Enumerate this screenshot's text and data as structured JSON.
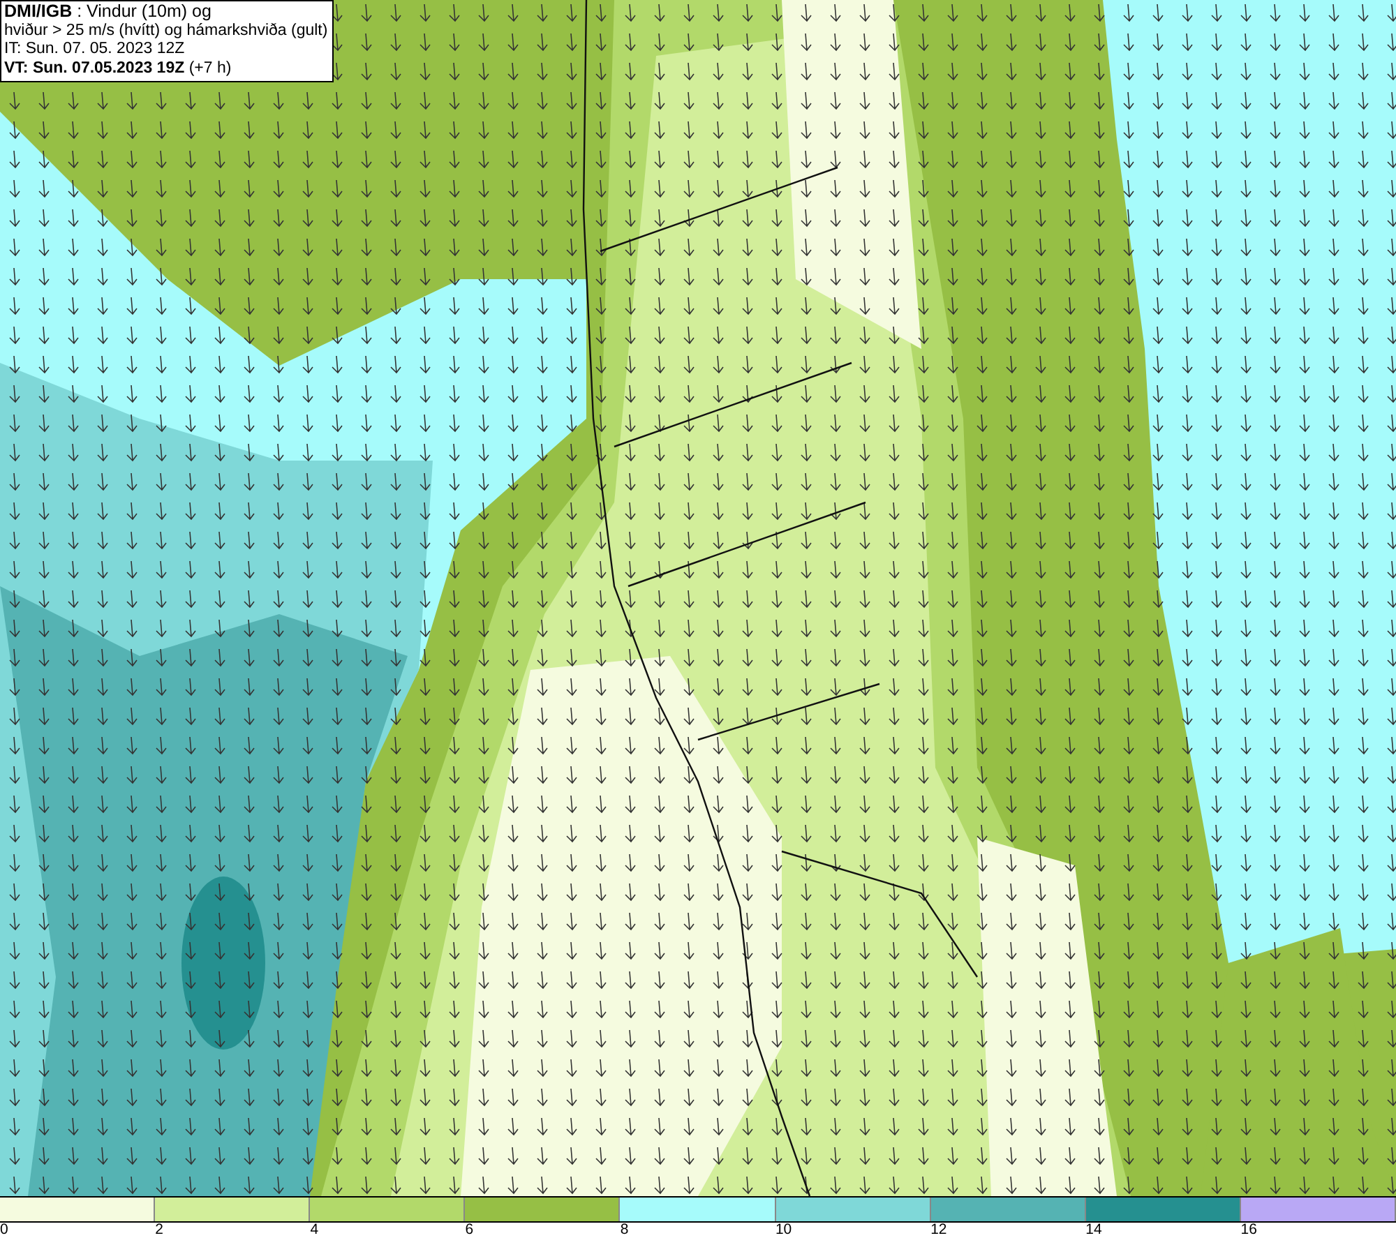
{
  "header": {
    "lines": [
      "**DMI/IGB** : Vindur (10m) og",
      "hviður > 25 m/s (hvítt) og hámarkshviða (gult)",
      "IT: Sun. 07. 05. 2023 12Z",
      "**VT: Sun. 07.05.2023 19Z** (+7 h)"
    ]
  },
  "legend": {
    "segments": [
      {
        "color": "#f5fbdf"
      },
      {
        "color": "#d2ee9a"
      },
      {
        "color": "#b2d96a"
      },
      {
        "color": "#96bf45"
      },
      {
        "color": "#a6fbfb"
      },
      {
        "color": "#7fd8d8"
      },
      {
        "color": "#55b3b3"
      },
      {
        "color": "#259090"
      },
      {
        "color": "#b9a8f5"
      }
    ],
    "ticks": [
      "0",
      "2",
      "4",
      "6",
      "8",
      "10",
      "12",
      "14",
      "16"
    ]
  }
}
